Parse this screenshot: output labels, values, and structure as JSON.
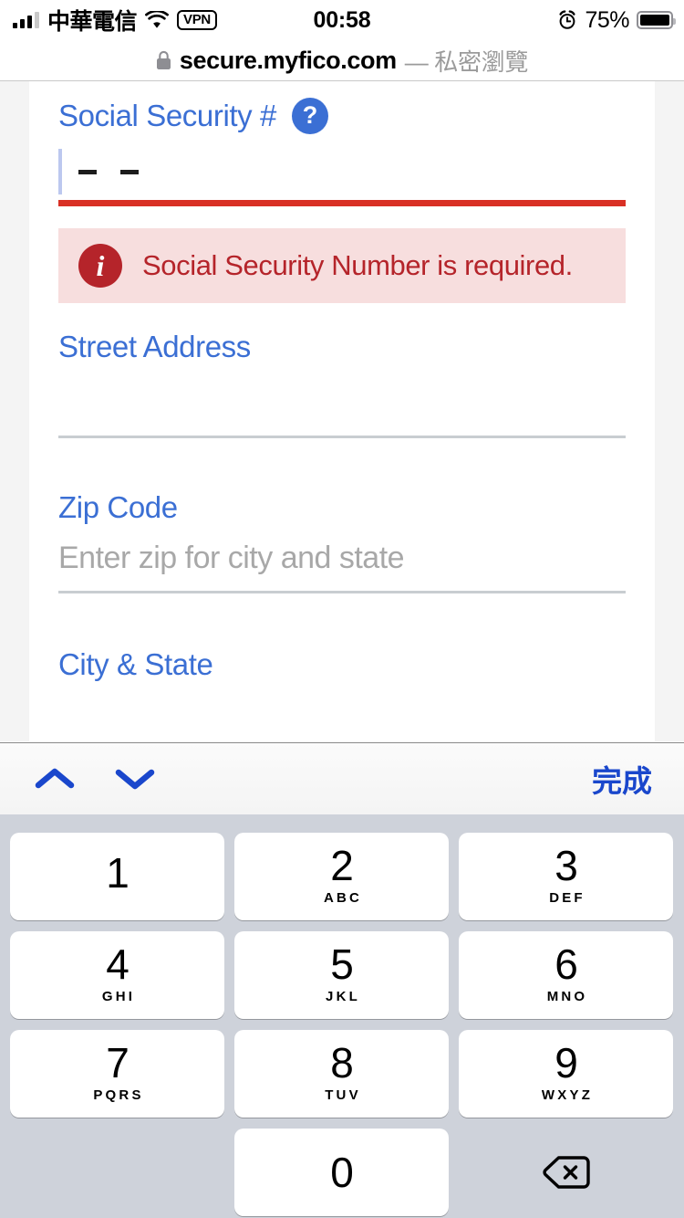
{
  "status_bar": {
    "carrier": "中華電信",
    "vpn_label": "VPN",
    "time": "00:58",
    "battery_percent": "75%",
    "signal_icon": "signal-bars-icon",
    "wifi_icon": "wifi-icon",
    "alarm_icon": "alarm-clock-icon",
    "battery_icon": "battery-icon"
  },
  "browser": {
    "lock_icon": "lock-icon",
    "url": "secure.myfico.com",
    "private_label": "— 私密瀏覽"
  },
  "form": {
    "ssn": {
      "label": "Social Security #",
      "help_icon": "question-mark-icon",
      "value": "",
      "mask_dashes": 2,
      "caret_visible": true,
      "has_error": true,
      "error_icon": "info-circle-icon",
      "error_message": "Social Security Number is required.",
      "error_underline_color": "#d93025",
      "error_background_color": "#f7dede",
      "error_text_color": "#b5242a"
    },
    "street": {
      "label": "Street Address",
      "value": "",
      "placeholder": ""
    },
    "zip": {
      "label": "Zip Code",
      "value": "",
      "placeholder": "Enter zip for city and state"
    },
    "city_state": {
      "label": "City & State",
      "value": ""
    },
    "label_color": "#3b6fd4",
    "underline_color": "#c8cdd1"
  },
  "keyboard": {
    "toolbar": {
      "prev_icon": "chevron-up-icon",
      "next_icon": "chevron-down-icon",
      "done_label": "完成",
      "accent_color": "#1a47cc"
    },
    "keys": [
      {
        "digit": "1",
        "letters": ""
      },
      {
        "digit": "2",
        "letters": "ABC"
      },
      {
        "digit": "3",
        "letters": "DEF"
      },
      {
        "digit": "4",
        "letters": "GHI"
      },
      {
        "digit": "5",
        "letters": "JKL"
      },
      {
        "digit": "6",
        "letters": "MNO"
      },
      {
        "digit": "7",
        "letters": "PQRS"
      },
      {
        "digit": "8",
        "letters": "TUV"
      },
      {
        "digit": "9",
        "letters": "WXYZ"
      },
      {
        "digit": "0",
        "letters": ""
      }
    ],
    "delete_icon": "delete-backspace-icon",
    "background_color": "#ced2da",
    "key_color": "#ffffff"
  }
}
